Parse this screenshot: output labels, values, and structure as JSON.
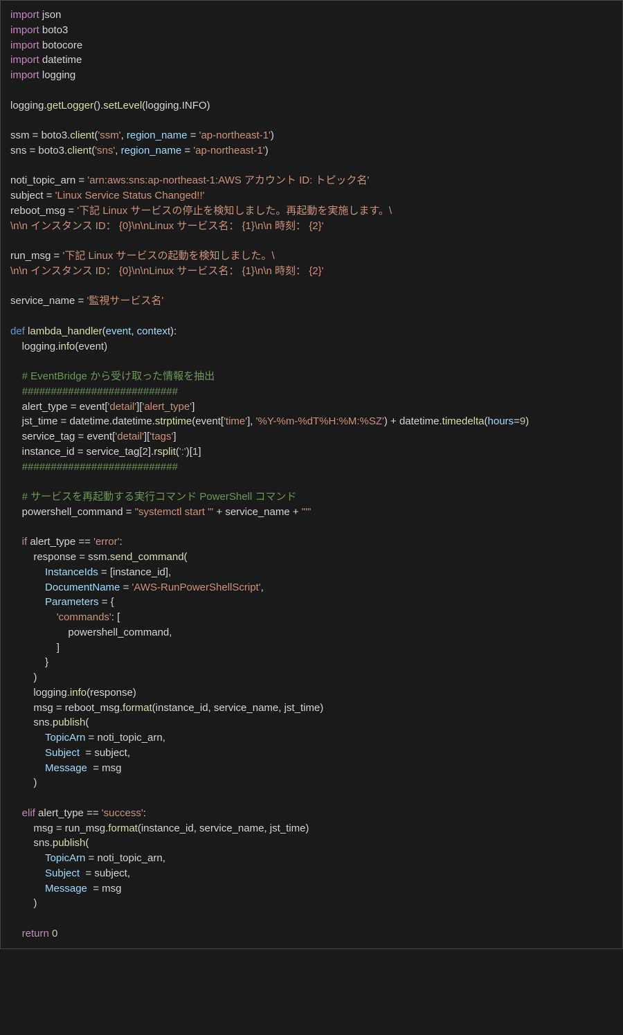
{
  "code": {
    "tokens": [
      [
        "kw",
        "import"
      ],
      [
        "mod",
        " json\n"
      ],
      [
        "kw",
        "import"
      ],
      [
        "mod",
        " boto3\n"
      ],
      [
        "kw",
        "import"
      ],
      [
        "mod",
        " botocore\n"
      ],
      [
        "kw",
        "import"
      ],
      [
        "mod",
        " datetime\n"
      ],
      [
        "kw",
        "import"
      ],
      [
        "mod",
        " logging\n"
      ],
      [
        "mod",
        "\n"
      ],
      [
        "mod",
        "logging."
      ],
      [
        "fn",
        "getLogger"
      ],
      [
        "mod",
        "()."
      ],
      [
        "fn",
        "setLevel"
      ],
      [
        "mod",
        "(logging.INFO)\n"
      ],
      [
        "mod",
        "\n"
      ],
      [
        "mod",
        "ssm = boto3."
      ],
      [
        "fn",
        "client"
      ],
      [
        "mod",
        "("
      ],
      [
        "str",
        "'ssm'"
      ],
      [
        "mod",
        ", "
      ],
      [
        "var",
        "region_name"
      ],
      [
        "mod",
        " = "
      ],
      [
        "str",
        "'ap-northeast-1'"
      ],
      [
        "mod",
        ")\n"
      ],
      [
        "mod",
        "sns = boto3."
      ],
      [
        "fn",
        "client"
      ],
      [
        "mod",
        "("
      ],
      [
        "str",
        "'sns'"
      ],
      [
        "mod",
        ", "
      ],
      [
        "var",
        "region_name"
      ],
      [
        "mod",
        " = "
      ],
      [
        "str",
        "'ap-northeast-1'"
      ],
      [
        "mod",
        ")\n"
      ],
      [
        "mod",
        "\n"
      ],
      [
        "mod",
        "noti_topic_arn = "
      ],
      [
        "str",
        "'arn:aws:sns:ap-northeast-1:AWS アカウント ID: トピック名'"
      ],
      [
        "mod",
        "\n"
      ],
      [
        "mod",
        "subject = "
      ],
      [
        "str",
        "'Linux Service Status Changed!!'"
      ],
      [
        "mod",
        "\n"
      ],
      [
        "mod",
        "reboot_msg = "
      ],
      [
        "str",
        "'下記 Linux サービスの停止を検知しました。再起動を実施します。\\\n\\n\\n インスタンス ID： {0}\\n\\nLinux サービス名： {1}\\n\\n 時刻： {2}'"
      ],
      [
        "mod",
        "\n"
      ],
      [
        "mod",
        "\n"
      ],
      [
        "mod",
        "run_msg = "
      ],
      [
        "str",
        "'下記 Linux サービスの起動を検知しました。\\\n\\n\\n インスタンス ID： {0}\\n\\nLinux サービス名： {1}\\n\\n 時刻： {2}'"
      ],
      [
        "mod",
        "\n"
      ],
      [
        "mod",
        "\n"
      ],
      [
        "mod",
        "service_name = "
      ],
      [
        "str",
        "'監視サービス名'"
      ],
      [
        "mod",
        "\n"
      ],
      [
        "mod",
        "\n"
      ],
      [
        "def",
        "def "
      ],
      [
        "fn",
        "lambda_handler"
      ],
      [
        "mod",
        "("
      ],
      [
        "var",
        "event"
      ],
      [
        "mod",
        ", "
      ],
      [
        "var",
        "context"
      ],
      [
        "mod",
        "):\n"
      ],
      [
        "mod",
        "    logging."
      ],
      [
        "fn",
        "info"
      ],
      [
        "mod",
        "(event)\n"
      ],
      [
        "mod",
        "\n"
      ],
      [
        "mod",
        "    "
      ],
      [
        "cmt",
        "# EventBridge から受け取った情報を抽出"
      ],
      [
        "mod",
        "\n"
      ],
      [
        "mod",
        "    "
      ],
      [
        "cmt",
        "###########################"
      ],
      [
        "mod",
        "\n"
      ],
      [
        "mod",
        "    alert_type = event["
      ],
      [
        "str",
        "'detail'"
      ],
      [
        "mod",
        "]["
      ],
      [
        "str",
        "'alert_type'"
      ],
      [
        "mod",
        "]\n"
      ],
      [
        "mod",
        "    jst_time = datetime.datetime."
      ],
      [
        "fn",
        "strptime"
      ],
      [
        "mod",
        "(event["
      ],
      [
        "str",
        "'time'"
      ],
      [
        "mod",
        "], "
      ],
      [
        "str",
        "'%Y-%m-%dT%H:%M:%SZ'"
      ],
      [
        "mod",
        ") + datetime."
      ],
      [
        "fn",
        "timedelta"
      ],
      [
        "mod",
        "("
      ],
      [
        "var",
        "hours"
      ],
      [
        "mod",
        "="
      ],
      [
        "num",
        "9"
      ],
      [
        "mod",
        ")\n"
      ],
      [
        "mod",
        "    service_tag = event["
      ],
      [
        "str",
        "'detail'"
      ],
      [
        "mod",
        "]["
      ],
      [
        "str",
        "'tags'"
      ],
      [
        "mod",
        "]\n"
      ],
      [
        "mod",
        "    instance_id = service_tag["
      ],
      [
        "num",
        "2"
      ],
      [
        "mod",
        "]."
      ],
      [
        "fn",
        "rsplit"
      ],
      [
        "mod",
        "("
      ],
      [
        "str",
        "':'"
      ],
      [
        "mod",
        ")["
      ],
      [
        "num",
        "1"
      ],
      [
        "mod",
        "]\n"
      ],
      [
        "mod",
        "    "
      ],
      [
        "cmt",
        "###########################"
      ],
      [
        "mod",
        "\n"
      ],
      [
        "mod",
        "\n"
      ],
      [
        "mod",
        "    "
      ],
      [
        "cmt",
        "# サービスを再起動する実行コマンド PowerShell コマンド"
      ],
      [
        "mod",
        "\n"
      ],
      [
        "mod",
        "    powershell_command = "
      ],
      [
        "str",
        "\"systemctl start '\""
      ],
      [
        "mod",
        " + service_name + "
      ],
      [
        "str",
        "\"'\""
      ],
      [
        "mod",
        "\n"
      ],
      [
        "mod",
        "\n"
      ],
      [
        "mod",
        "    "
      ],
      [
        "kw",
        "if"
      ],
      [
        "mod",
        " alert_type == "
      ],
      [
        "str",
        "'error'"
      ],
      [
        "mod",
        ":\n"
      ],
      [
        "mod",
        "        response = ssm."
      ],
      [
        "fn",
        "send_command"
      ],
      [
        "mod",
        "(\n"
      ],
      [
        "mod",
        "            "
      ],
      [
        "var",
        "InstanceIds"
      ],
      [
        "mod",
        " = [instance_id],\n"
      ],
      [
        "mod",
        "            "
      ],
      [
        "var",
        "DocumentName"
      ],
      [
        "mod",
        " = "
      ],
      [
        "str",
        "'AWS-RunPowerShellScript'"
      ],
      [
        "mod",
        ",\n"
      ],
      [
        "mod",
        "            "
      ],
      [
        "var",
        "Parameters"
      ],
      [
        "mod",
        " = {\n"
      ],
      [
        "mod",
        "                "
      ],
      [
        "str",
        "'commands'"
      ],
      [
        "mod",
        ": [\n"
      ],
      [
        "mod",
        "                    powershell_command,\n"
      ],
      [
        "mod",
        "                ]\n"
      ],
      [
        "mod",
        "            }\n"
      ],
      [
        "mod",
        "        )\n"
      ],
      [
        "mod",
        "        logging."
      ],
      [
        "fn",
        "info"
      ],
      [
        "mod",
        "(response)\n"
      ],
      [
        "mod",
        "        msg = reboot_msg."
      ],
      [
        "fn",
        "format"
      ],
      [
        "mod",
        "(instance_id, service_name, jst_time)\n"
      ],
      [
        "mod",
        "        sns."
      ],
      [
        "fn",
        "publish"
      ],
      [
        "mod",
        "(\n"
      ],
      [
        "mod",
        "            "
      ],
      [
        "var",
        "TopicArn"
      ],
      [
        "mod",
        " = noti_topic_arn,\n"
      ],
      [
        "mod",
        "            "
      ],
      [
        "var",
        "Subject"
      ],
      [
        "mod",
        "  = subject,\n"
      ],
      [
        "mod",
        "            "
      ],
      [
        "var",
        "Message"
      ],
      [
        "mod",
        "  = msg\n"
      ],
      [
        "mod",
        "        )\n"
      ],
      [
        "mod",
        "\n"
      ],
      [
        "mod",
        "    "
      ],
      [
        "kw",
        "elif"
      ],
      [
        "mod",
        " alert_type == "
      ],
      [
        "str",
        "'success'"
      ],
      [
        "mod",
        ":\n"
      ],
      [
        "mod",
        "        msg = run_msg."
      ],
      [
        "fn",
        "format"
      ],
      [
        "mod",
        "(instance_id, service_name, jst_time)\n"
      ],
      [
        "mod",
        "        sns."
      ],
      [
        "fn",
        "publish"
      ],
      [
        "mod",
        "(\n"
      ],
      [
        "mod",
        "            "
      ],
      [
        "var",
        "TopicArn"
      ],
      [
        "mod",
        " = noti_topic_arn,\n"
      ],
      [
        "mod",
        "            "
      ],
      [
        "var",
        "Subject"
      ],
      [
        "mod",
        "  = subject,\n"
      ],
      [
        "mod",
        "            "
      ],
      [
        "var",
        "Message"
      ],
      [
        "mod",
        "  = msg\n"
      ],
      [
        "mod",
        "        )\n"
      ],
      [
        "mod",
        "\n"
      ],
      [
        "mod",
        "    "
      ],
      [
        "kw",
        "return"
      ],
      [
        "mod",
        " "
      ],
      [
        "num",
        "0"
      ],
      [
        "mod",
        "\n"
      ]
    ]
  }
}
